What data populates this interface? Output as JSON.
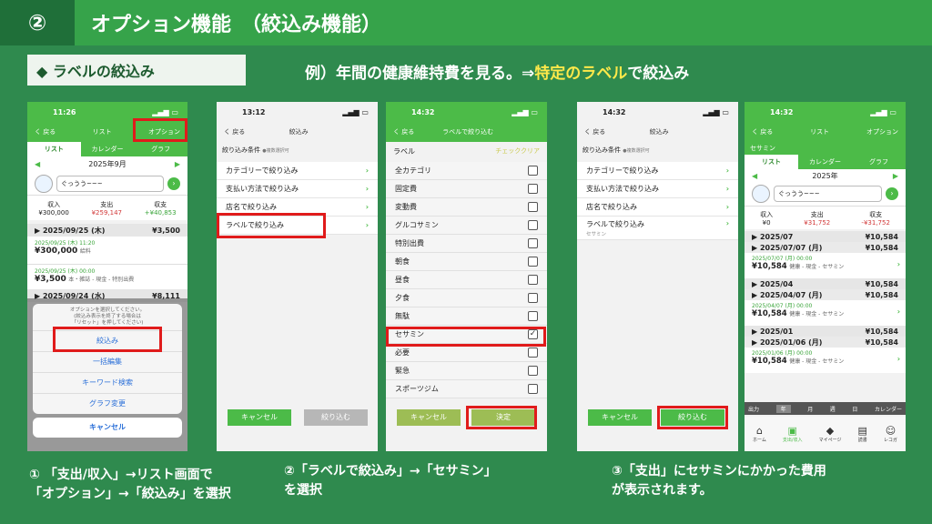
{
  "header": {
    "number": "②",
    "title": "オプション機能　（絞込み機能）"
  },
  "section": {
    "label": "◆ ラベルの絞込み"
  },
  "example": {
    "prefix": "例）年間の健康維持費を見る。⇒",
    "highlight": "特定のラベル",
    "suffix": "で絞込み"
  },
  "p1": {
    "time": "11:26",
    "back": "く 戻る",
    "title": "リスト",
    "option": "オプション",
    "tabs": [
      "リスト",
      "カレンダー",
      "グラフ"
    ],
    "month": "2025年9月",
    "memo": "ぐっうう~~~",
    "labels": {
      "income": "収入",
      "expense": "支出",
      "balance": "収支"
    },
    "values": {
      "income": "¥300,000",
      "expense": "¥259,147",
      "balance": "+¥40,853"
    },
    "day1": {
      "date": "▶ 2025/09/25 (木)",
      "total": "¥3,500"
    },
    "e1": {
      "time": "2025/09/25 (木) 11:20",
      "amount": "¥300,000",
      "cat": "給料"
    },
    "e2": {
      "time": "2025/09/25 (木) 00:00",
      "amount": "¥3,500",
      "cat": "本・雑誌 - 現金 - 特別出費"
    },
    "day2": {
      "date": "▶ 2025/09/24 (水)",
      "total": "¥8,111"
    },
    "sheet": {
      "msg1": "オプションを選択してください。",
      "msg2": "(絞込み表示を終了する場合は",
      "msg3": "「リセット」を押してください)",
      "filter": "絞込み",
      "bulk": "一括編集",
      "keyword": "キーワード検索",
      "graph": "グラフ変更",
      "cancel": "キャンセル"
    }
  },
  "p2": {
    "time": "13:12",
    "back": "く 戻る",
    "title": "絞込み",
    "cond": "絞り込み条件",
    "cond_sub": "●複数選択可",
    "items": [
      "カテゴリーで絞り込み",
      "支払い方法で絞り込み",
      "店名で絞り込み",
      "ラベルで絞り込み"
    ],
    "cancel": "キャンセル",
    "apply": "絞り込む"
  },
  "p3": {
    "time": "14:32",
    "back": "く 戻る",
    "title": "ラベルで絞り込む",
    "label": "ラベル",
    "clear": "チェッククリア",
    "items": [
      "全カテゴリ",
      "固定費",
      "変動費",
      "グルコサミン",
      "特別出費",
      "朝食",
      "昼食",
      "夕食",
      "無駄",
      "セサミン",
      "必要",
      "緊急",
      "スポーツジム"
    ],
    "cancel": "キャンセル",
    "ok": "決定"
  },
  "p4": {
    "time": "14:32",
    "back": "く 戻る",
    "title": "絞込み",
    "cond": "絞り込み条件",
    "cond_sub": "●複数選択可",
    "items": [
      "カテゴリーで絞り込み",
      "支払い方法で絞り込み",
      "店名で絞り込み",
      "ラベルで絞り込み"
    ],
    "sub": "セサミン",
    "cancel": "キャンセル",
    "apply": "絞り込む"
  },
  "p5": {
    "time": "14:32",
    "back": "く 戻る",
    "title": "リスト",
    "option": "オプション",
    "filter_label": "セサミン",
    "tabs": [
      "リスト",
      "カレンダー",
      "グラフ"
    ],
    "year": "2025年",
    "memo": "ぐっうう~~~",
    "labels": {
      "income": "収入",
      "expense": "支出",
      "balance": "収支"
    },
    "values": {
      "income": "¥0",
      "expense": "¥31,752",
      "balance": "-¥31,752"
    },
    "groups": [
      {
        "month": "▶ 2025/07",
        "mtotal": "¥10,584",
        "day": "▶ 2025/07/07 (月)",
        "dtotal": "¥10,584",
        "time": "2025/07/07 (月) 00:00",
        "amount": "¥10,584",
        "cat": "健康 - 現金 - セサミン"
      },
      {
        "month": "▶ 2025/04",
        "mtotal": "¥10,584",
        "day": "▶ 2025/04/07 (月)",
        "dtotal": "¥10,584",
        "time": "2025/04/07 (月) 00:00",
        "amount": "¥10,584",
        "cat": "健康 - 現金 - セサミン"
      },
      {
        "month": "▶ 2025/01",
        "mtotal": "¥10,584",
        "day": "▶ 2025/01/06 (月)",
        "dtotal": "¥10,584",
        "time": "2025/01/06 (月) 00:00",
        "amount": "¥10,584",
        "cat": "健康 - 現金 - セサミン"
      }
    ],
    "toolbar": [
      "出力",
      "年",
      "月",
      "週",
      "日",
      "カレンダー"
    ],
    "bottom": [
      "ホーム",
      "支出/収入",
      "マイページ",
      "読書",
      "レコガ"
    ]
  },
  "captions": {
    "c1a": "① 「支出/収入」→リスト画面で",
    "c1b": "「オプション」→「絞込み」を選択",
    "c2a": "②「ラベルで絞込み」→「セサミン」",
    "c2b": "を選択",
    "c3a": "③「支出」にセサミンにかかった費用",
    "c3b": "が表示されます。"
  }
}
